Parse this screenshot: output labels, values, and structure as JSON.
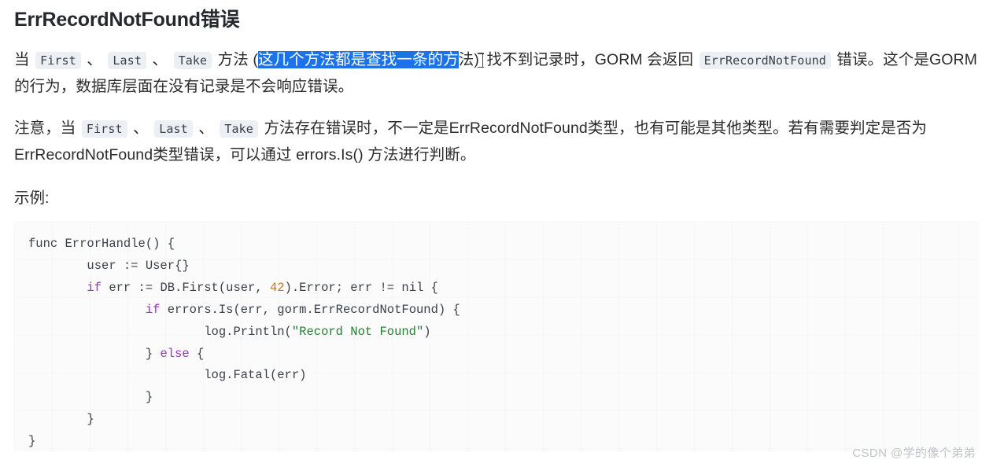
{
  "heading": "ErrRecordNotFound错误",
  "paragraph1": {
    "seg1": "当 ",
    "chip1": "First",
    "sep1": " 、 ",
    "chip2": "Last",
    "sep2": " 、 ",
    "chip3": "Take",
    "seg2": " 方法 (",
    "selected": "这几个方法都是查找一条的方",
    "after_selection": "法)",
    "seg3": " 找不到记录时，GORM 会返回 ",
    "chip4": "ErrRecordNotFound",
    "seg4": " 错误。这个是GORM的行为，数据库层面在没有记录是不会响应错误。"
  },
  "paragraph2": {
    "seg1": "注意，当 ",
    "chip1": "First",
    "sep1": " 、 ",
    "chip2": "Last",
    "sep2": " 、 ",
    "chip3": "Take",
    "seg2": " 方法存在错误时，不一定是ErrRecordNotFound类型，也有可能是其他类型。若有需要判定是否为ErrRecordNotFound类型错误，可以通过 errors.Is() 方法进行判断。"
  },
  "example_label": "示例:",
  "code": {
    "language": "go",
    "lines": [
      [
        {
          "t": "func ErrorHandle() {",
          "c": "plain"
        }
      ],
      [
        {
          "t": "        user := User{}",
          "c": "plain"
        }
      ],
      [
        {
          "t": "        ",
          "c": "plain"
        },
        {
          "t": "if",
          "c": "kw"
        },
        {
          "t": " err := DB.First(user, ",
          "c": "plain"
        },
        {
          "t": "42",
          "c": "num"
        },
        {
          "t": ").Error; err != nil {",
          "c": "plain"
        }
      ],
      [
        {
          "t": "                ",
          "c": "plain"
        },
        {
          "t": "if",
          "c": "kw"
        },
        {
          "t": " errors.Is(err, gorm.ErrRecordNotFound) {",
          "c": "plain"
        }
      ],
      [
        {
          "t": "                        log.Println(",
          "c": "plain"
        },
        {
          "t": "\"Record Not Found\"",
          "c": "str"
        },
        {
          "t": ")",
          "c": "plain"
        }
      ],
      [
        {
          "t": "                } ",
          "c": "plain"
        },
        {
          "t": "else",
          "c": "kw"
        },
        {
          "t": " {",
          "c": "plain"
        }
      ],
      [
        {
          "t": "                        log.Fatal(err)",
          "c": "plain"
        }
      ],
      [
        {
          "t": "                }",
          "c": "plain"
        }
      ],
      [
        {
          "t": "        }",
          "c": "plain"
        }
      ],
      [
        {
          "t": "}",
          "c": "plain"
        }
      ]
    ]
  },
  "watermark": "CSDN @学的像个弟弟",
  "colors": {
    "selection_blue": "#1a73e8",
    "chip_bg": "#eceff3",
    "keyword_purple": "#9b35c4",
    "string_green": "#267d33",
    "number_orange": "#c0791f",
    "code_bg": "#fbfbfc",
    "watermark_gray": "#bfc3c7"
  }
}
